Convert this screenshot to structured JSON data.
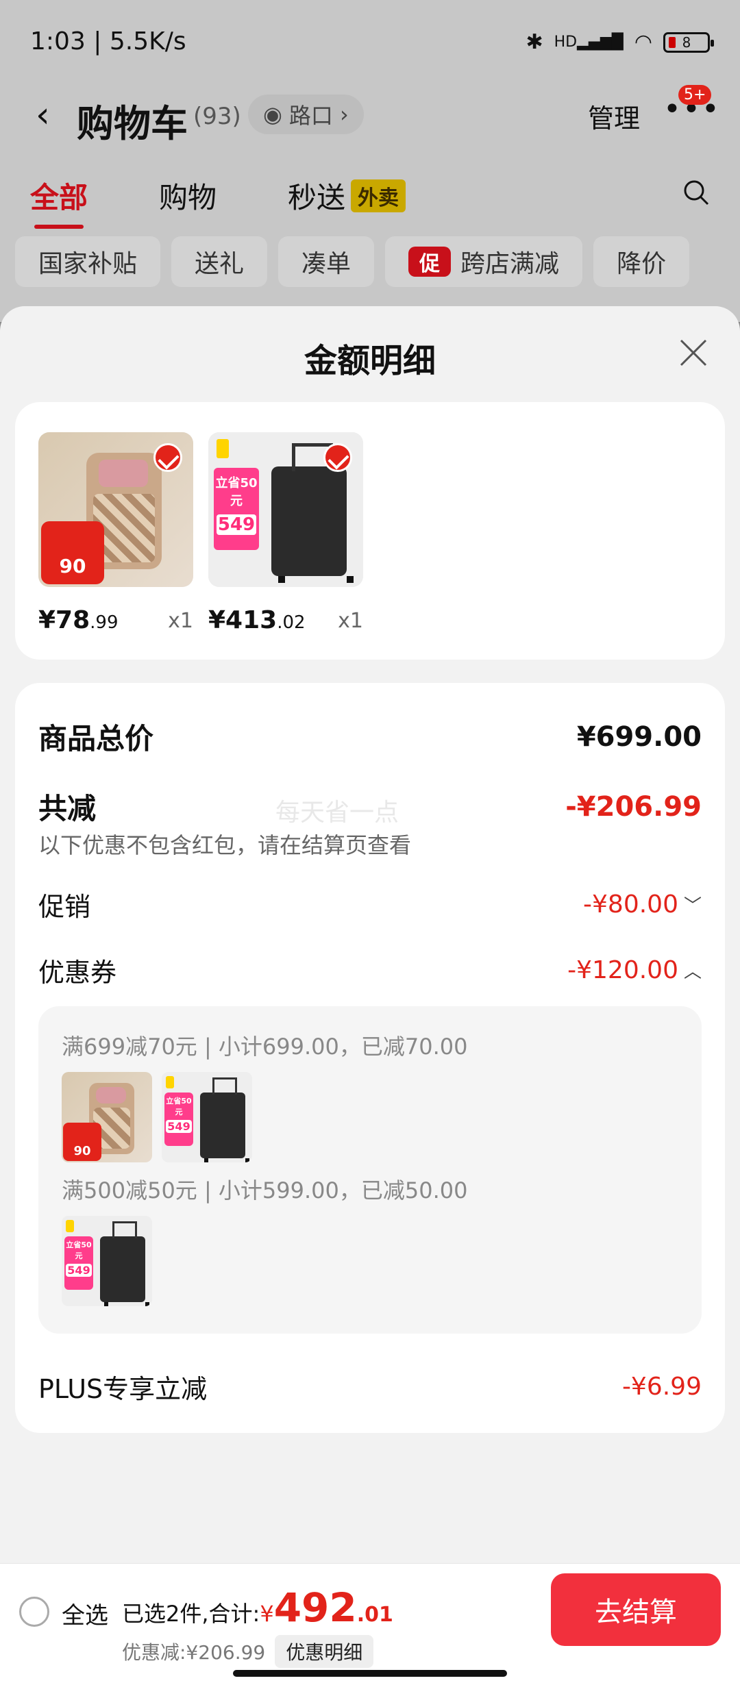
{
  "status": {
    "time_speed": "1:03 | 5.5K/s",
    "network": "HD",
    "battery": "8"
  },
  "nav": {
    "back": "‹",
    "title": "购物车",
    "count": "(93)",
    "road": "路口",
    "manage": "管理",
    "badge": "5+",
    "more": "•••"
  },
  "tabs": [
    {
      "label": "全部"
    },
    {
      "label": "购物"
    },
    {
      "label": "秒送"
    }
  ],
  "tab_tag": "外卖",
  "chips": [
    "国家补贴",
    "送礼",
    "凑单",
    "跨店满减",
    "降价"
  ],
  "promo_mark": "促",
  "sheet": {
    "title": "金额明细"
  },
  "products": [
    {
      "price_main": "¥78",
      "price_dec": ".99",
      "qty": "x1",
      "tag": "90"
    },
    {
      "price_main": "¥413",
      "price_dec": ".02",
      "qty": "x1",
      "tag_top": "立省50元",
      "tag_price": "549"
    }
  ],
  "detail": {
    "total_label": "商品总价",
    "total_value": "¥699.00",
    "reduce_label": "共减",
    "reduce_value": "-¥206.99",
    "note": "以下优惠不包含红包，请在结算页查看",
    "watermark": "每天省一点",
    "promo_label": "促销",
    "promo_value": "-¥80.00",
    "coupon_label": "优惠券",
    "coupon_value": "-¥120.00",
    "coupon_lines": [
      "满699减70元 | 小计699.00，已减70.00",
      "满500减50元 | 小计599.00，已减50.00"
    ],
    "plus_label": "PLUS专享立减",
    "plus_value": "-¥6.99"
  },
  "bottom": {
    "select_all": "全选",
    "summary_prefix": "已选2件,合计:",
    "yen": "¥",
    "amount": "492",
    "decimal": ".01",
    "discount_text": "优惠减:¥206.99",
    "discount_detail": "优惠明细",
    "checkout": "去结算"
  }
}
